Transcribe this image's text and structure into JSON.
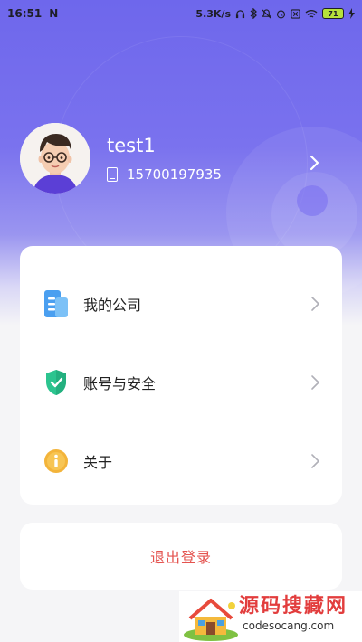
{
  "status_bar": {
    "time": "16:51",
    "network_speed": "5.3K/s",
    "battery_level": "71",
    "icons": [
      "n-icon",
      "headphones-icon",
      "bluetooth-icon",
      "mute-icon",
      "alarm-icon",
      "sim-icon",
      "wifi-icon",
      "charging-icon"
    ]
  },
  "profile": {
    "username": "test1",
    "phone": "15700197935",
    "avatar": "avatar-illustration"
  },
  "menu": {
    "items": [
      {
        "label": "我的公司",
        "icon": "document-icon"
      },
      {
        "label": "账号与安全",
        "icon": "shield-check-icon"
      },
      {
        "label": "关于",
        "icon": "info-icon"
      }
    ]
  },
  "logout": {
    "label": "退出登录"
  },
  "watermark": {
    "title": "源码搜藏网",
    "url": "codesocang.com"
  },
  "colors": {
    "header_gradient_top": "#6e67ec",
    "logout_text": "#e4534f",
    "doc_icon": "#4a9ff0",
    "shield_icon": "#2cc48f",
    "info_icon": "#f3b43a"
  }
}
